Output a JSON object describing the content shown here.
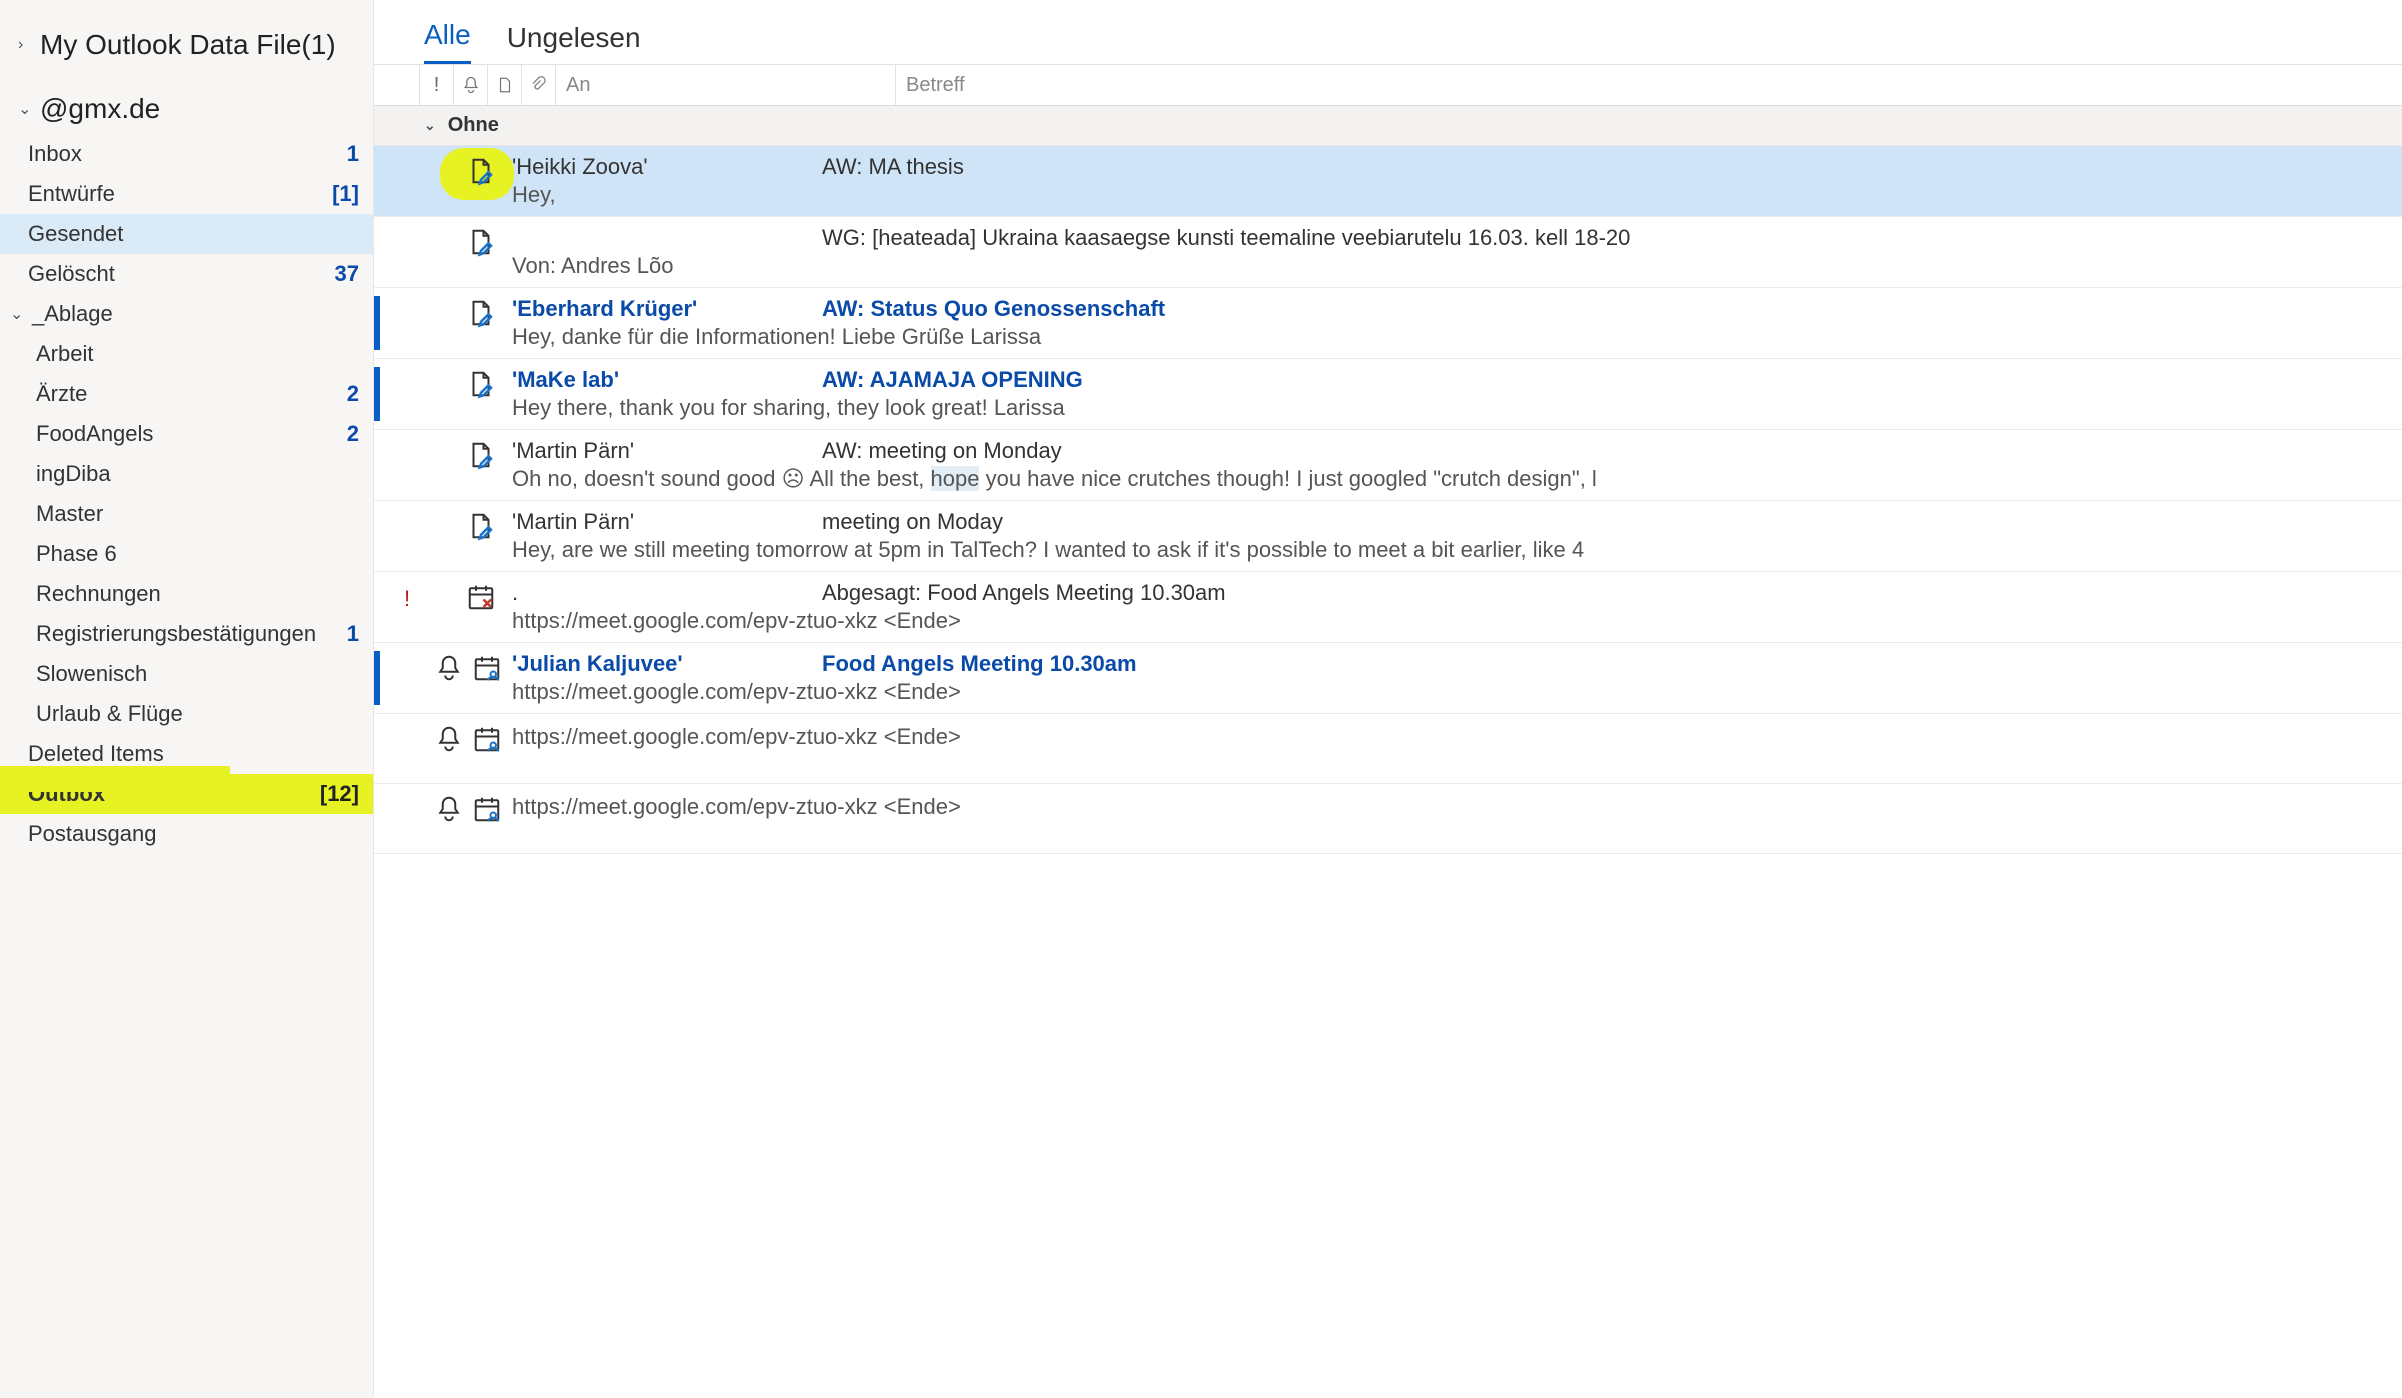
{
  "sidebar": {
    "pst": {
      "label": "My Outlook Data File(1)"
    },
    "account": {
      "label": "@gmx.de"
    },
    "folders": [
      {
        "label": "Inbox",
        "count": "1"
      },
      {
        "label": "Entwürfe",
        "count": "[1]"
      },
      {
        "label": "Gesendet",
        "count": "",
        "selected": true
      },
      {
        "label": "Gelöscht",
        "count": "37"
      }
    ],
    "ablage_label": "_Ablage",
    "ablage": [
      {
        "label": "Arbeit",
        "count": ""
      },
      {
        "label": "Ärzte",
        "count": "2"
      },
      {
        "label": "FoodAngels",
        "count": "2"
      },
      {
        "label": "ingDiba",
        "count": ""
      },
      {
        "label": "Master",
        "count": ""
      },
      {
        "label": "Phase 6",
        "count": ""
      },
      {
        "label": "Rechnungen",
        "count": ""
      },
      {
        "label": "Registrierungsbestätigungen",
        "count": "1"
      },
      {
        "label": "Slowenisch",
        "count": ""
      },
      {
        "label": "Urlaub & Flüge",
        "count": ""
      }
    ],
    "deleted": {
      "label": "Deleted Items"
    },
    "outbox": {
      "label": "Outbox",
      "count": "[12]"
    },
    "postausgang": {
      "label": "Postausgang"
    }
  },
  "tabs": {
    "all": "Alle",
    "unread": "Ungelesen"
  },
  "columns": {
    "an": "An",
    "betreff": "Betreff"
  },
  "group": {
    "label": "Ohne"
  },
  "messages": [
    {
      "unread": false,
      "selected": true,
      "highlight_icon": true,
      "icon": "draft",
      "recipient": "'Heikki Zoova'",
      "subject": "AW: MA thesis",
      "preview": "Hey,"
    },
    {
      "unread": false,
      "icon": "draft",
      "recipient": "",
      "subject": "WG: [heateada] Ukraina kaasaegse kunsti teemaline veebiarutelu 16.03. kell 18-20",
      "preview": "Von: Andres Lõo"
    },
    {
      "unread": true,
      "icon": "draft",
      "recipient": "'Eberhard Krüger'",
      "subject": "AW: Status Quo Genossenschaft",
      "preview": "Hey,  danke für die Informationen!   Liebe Grüße  Larissa"
    },
    {
      "unread": true,
      "icon": "draft",
      "recipient": "'MaKe lab'",
      "subject": "AW: AJAMAJA OPENING",
      "preview": "Hey there,  thank you for sharing, they look great!  Larissa"
    },
    {
      "unread": false,
      "icon": "draft",
      "recipient": "'Martin Pärn'",
      "subject": "AW: meeting on Monday",
      "preview_pre": "Oh no, doesn't sound good ☹ All the best, ",
      "preview_hl": "hope",
      "preview_post": " you have nice crutches though! I just googled \"crutch design\", l"
    },
    {
      "unread": false,
      "icon": "draft",
      "recipient": "'Martin Pärn'",
      "subject": "meeting on Moday",
      "preview": "Hey,  are we still meeting tomorrow at 5pm in TalTech?  I wanted to ask if it's possible to meet a bit earlier, like 4"
    },
    {
      "unread": false,
      "icon": "cal-cancel",
      "importance": true,
      "recipient": ".",
      "subject": "Abgesagt: Food Angels Meeting 10.30am",
      "preview": "https://meet.google.com/epv-ztuo-xkz <Ende>"
    },
    {
      "unread": true,
      "icon": "bell-cal",
      "recipient": "'Julian Kaljuvee'",
      "subject": "Food Angels Meeting 10.30am",
      "preview": "https://meet.google.com/epv-ztuo-xkz <Ende>"
    },
    {
      "unread": false,
      "icon": "bell-cal",
      "recipient": "",
      "subject": "",
      "preview": "https://meet.google.com/epv-ztuo-xkz <Ende>"
    },
    {
      "unread": false,
      "icon": "bell-cal",
      "recipient": "",
      "subject": "",
      "preview": "https://meet.google.com/epv-ztuo-xkz <Ende>"
    }
  ]
}
